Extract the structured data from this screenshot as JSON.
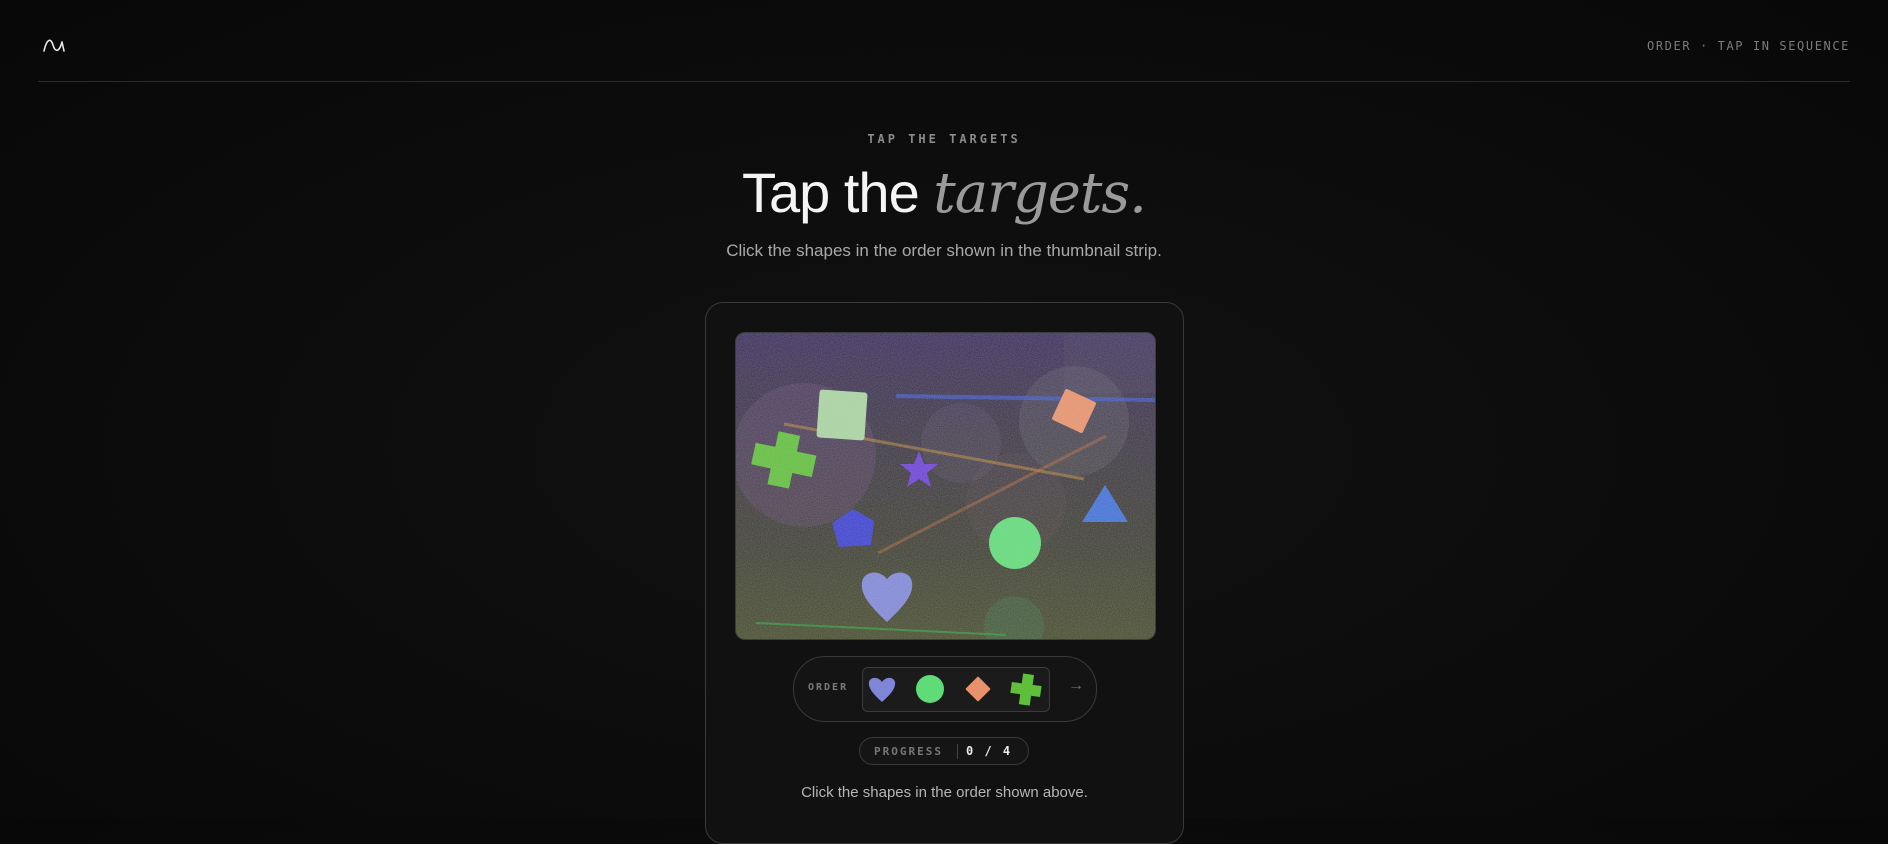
{
  "header": {
    "logo_icon": "wave-logo-icon",
    "mode_label": "ORDER · TAP IN SEQUENCE"
  },
  "hero": {
    "eyebrow": "TAP THE TARGETS",
    "title_plain": "Tap the ",
    "title_emphasis": "targets.",
    "subtitle": "Click the shapes in the order shown in the thumbnail strip."
  },
  "puzzle": {
    "canvas_shapes": [
      {
        "shape": "square",
        "color": "#a8d4a0"
      },
      {
        "shape": "diamond",
        "color": "#e8916a"
      },
      {
        "shape": "cross",
        "color": "#5fbf3a"
      },
      {
        "shape": "star",
        "color": "#6a3fd8"
      },
      {
        "shape": "triangle",
        "color": "#3f6fd8"
      },
      {
        "shape": "pentagon",
        "color": "#3a3fd0"
      },
      {
        "shape": "circle",
        "color": "#5fdc78"
      },
      {
        "shape": "heart",
        "color": "#7f86d8"
      }
    ],
    "order": {
      "label": "ORDER",
      "thumbnails": [
        {
          "shape": "heart",
          "color": "#7f86d8"
        },
        {
          "shape": "circle",
          "color": "#5fdc78"
        },
        {
          "shape": "diamond",
          "color": "#e8916a"
        },
        {
          "shape": "cross",
          "color": "#5fbf3a"
        }
      ],
      "arrow": "→"
    },
    "progress": {
      "label": "PROGRESS",
      "value": "0 / 4",
      "completed": 0,
      "total": 4
    },
    "instruction": "Click the shapes in the order shown above."
  }
}
